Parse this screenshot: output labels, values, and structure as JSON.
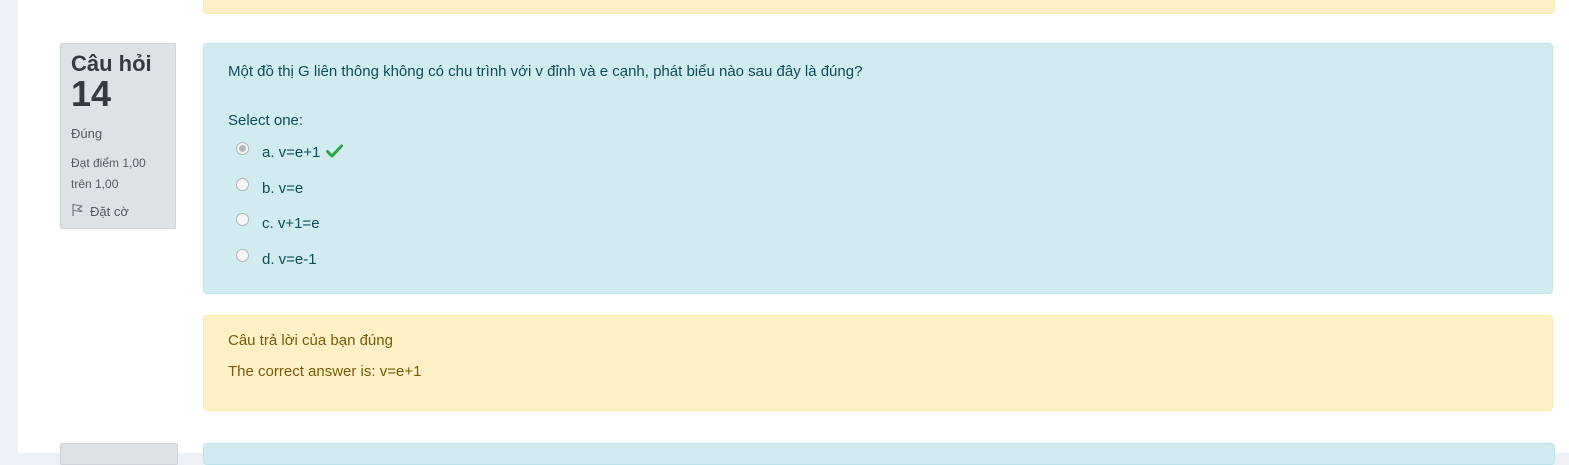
{
  "question": {
    "title": "Câu hỏi",
    "number": "14",
    "state": "Đúng",
    "grade": "Đạt điểm 1,00 trên 1,00",
    "flag_label": "Đặt cờ",
    "text": "Một đồ thị G liên thông không có chu trình với  v đỉnh và e cạnh, phát biểu nào sau đây là đúng?",
    "prompt": "Select one:",
    "answers": [
      {
        "label": "a. v=e+1",
        "selected": true,
        "correct": true
      },
      {
        "label": "b. v=e",
        "selected": false
      },
      {
        "label": "c. v+1=e",
        "selected": false
      },
      {
        "label": "d. v=e-1",
        "selected": false
      }
    ]
  },
  "feedback": {
    "specific": "Câu trả lời của bạn đúng",
    "right_answer": "The correct answer is: v=e+1"
  },
  "colors": {
    "correct_check": "#28a745",
    "qtext_bg": "#d1ebf0",
    "feedback_bg": "#fff0c6",
    "info_bg": "#dee2e6"
  }
}
